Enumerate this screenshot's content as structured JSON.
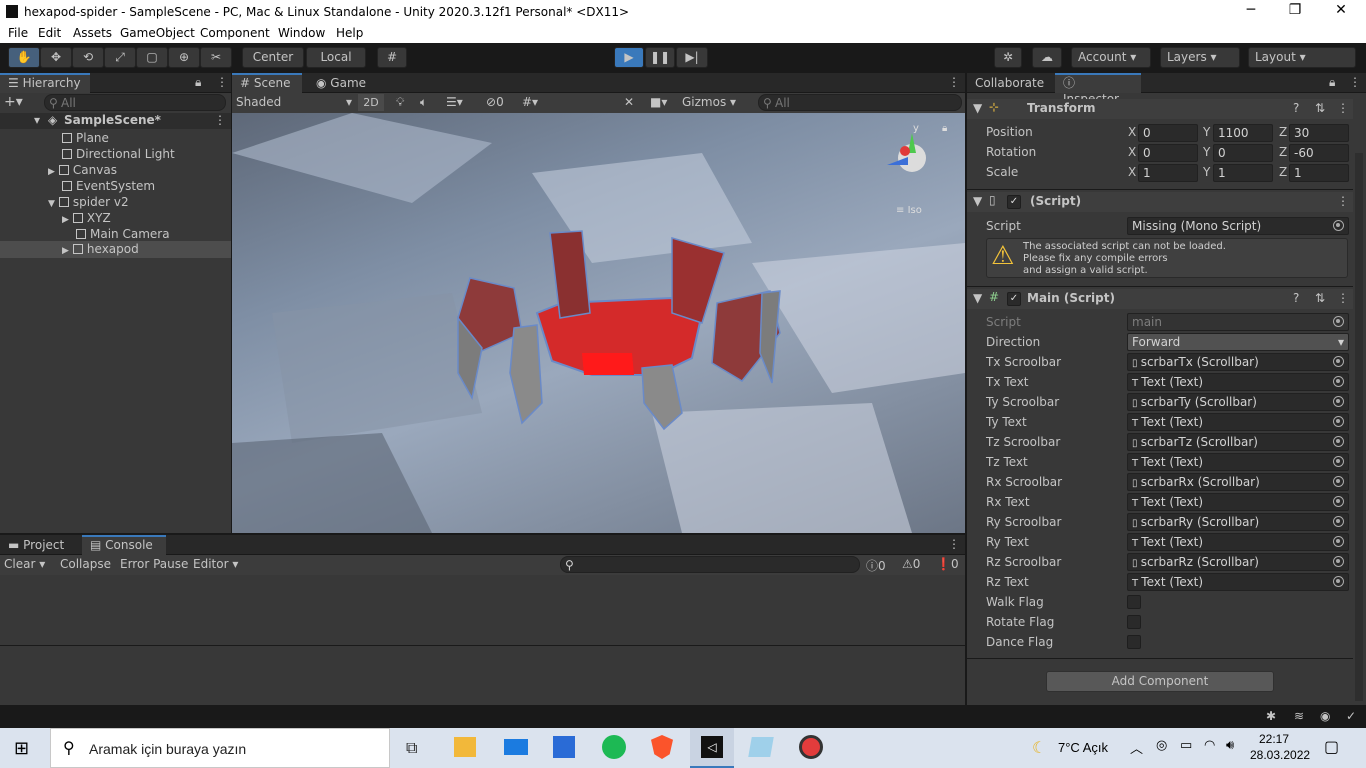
{
  "window": {
    "title": "hexapod-spider - SampleScene - PC, Mac & Linux Standalone - Unity 2020.3.12f1 Personal* <DX11>",
    "minimize": "─",
    "maximize": "❐",
    "close": "✕"
  },
  "menu": [
    "File",
    "Edit",
    "Assets",
    "GameObject",
    "Component",
    "Window",
    "Help"
  ],
  "toolbar": {
    "pivot": "Center",
    "space": "Local",
    "account": "Account",
    "layers": "Layers",
    "layout": "Layout"
  },
  "hierarchy": {
    "tab": "Hierarchy",
    "search_placeholder": "All",
    "scene": "SampleScene*",
    "items": [
      {
        "label": "Plane"
      },
      {
        "label": "Directional Light"
      },
      {
        "label": "Canvas"
      },
      {
        "label": "EventSystem"
      },
      {
        "label": "spider v2"
      },
      {
        "label": "XYZ"
      },
      {
        "label": "Main Camera"
      },
      {
        "label": "hexapod"
      }
    ]
  },
  "scene": {
    "tab_scene": "Scene",
    "tab_game": "Game",
    "shading": "Shaded",
    "mode2d": "2D",
    "hidden_count": "0",
    "gizmos": "Gizmos",
    "search_placeholder": "All",
    "iso_label": "Iso",
    "axis_y": "y",
    "axis_x": "x"
  },
  "bottom": {
    "tab_project": "Project",
    "tab_console": "Console",
    "clear": "Clear",
    "collapse": "Collapse",
    "error_pause": "Error Pause",
    "editor": "Editor",
    "log_count": "0",
    "warn_count": "0",
    "error_count": "0"
  },
  "inspector": {
    "tab_collab": "Collaborate",
    "tab_inspector": "Inspector",
    "transform": {
      "title": "Transform",
      "position_label": "Position",
      "rotation_label": "Rotation",
      "scale_label": "Scale",
      "x": "X",
      "y": "Y",
      "z": "Z",
      "pos": [
        "0",
        "1100",
        "30"
      ],
      "rot": [
        "0",
        "0",
        "-60"
      ],
      "scale": [
        "1",
        "1",
        "1"
      ]
    },
    "missing": {
      "title": "(Script)",
      "script_label": "Script",
      "script_value": "Missing (Mono Script)",
      "warning1": "The associated script can not be loaded.",
      "warning2": "Please fix any compile errors",
      "warning3": "and assign a valid script."
    },
    "main": {
      "title": "Main (Script)",
      "script_label": "Script",
      "script_value": "main",
      "direction_label": "Direction",
      "direction_value": "Forward",
      "fields": [
        {
          "label": "Tx Scroolbar",
          "value": "scrbarTx (Scrollbar)"
        },
        {
          "label": "Tx Text",
          "value": "Text (Text)"
        },
        {
          "label": "Ty Scroolbar",
          "value": "scrbarTy (Scrollbar)"
        },
        {
          "label": "Ty Text",
          "value": "Text (Text)"
        },
        {
          "label": "Tz Scroolbar",
          "value": "scrbarTz (Scrollbar)"
        },
        {
          "label": "Tz Text",
          "value": "Text (Text)"
        },
        {
          "label": "Rx Scroolbar",
          "value": "scrbarRx (Scrollbar)"
        },
        {
          "label": "Rx Text",
          "value": "Text (Text)"
        },
        {
          "label": "Ry Scroolbar",
          "value": "scrbarRy (Scrollbar)"
        },
        {
          "label": "Ry Text",
          "value": "Text (Text)"
        },
        {
          "label": "Rz Scroolbar",
          "value": "scrbarRz (Scrollbar)"
        },
        {
          "label": "Rz Text",
          "value": "Text (Text)"
        }
      ],
      "flags": [
        {
          "label": "Walk Flag"
        },
        {
          "label": "Rotate Flag"
        },
        {
          "label": "Dance Flag"
        }
      ]
    },
    "add_component": "Add Component"
  },
  "taskbar": {
    "search": "Aramak için buraya yazın",
    "weather": "7°C  Açık",
    "time": "22:17",
    "date": "28.03.2022"
  },
  "colors": {
    "accent": "#3a79bb",
    "play_active": "#46607c",
    "panel": "#383838"
  }
}
